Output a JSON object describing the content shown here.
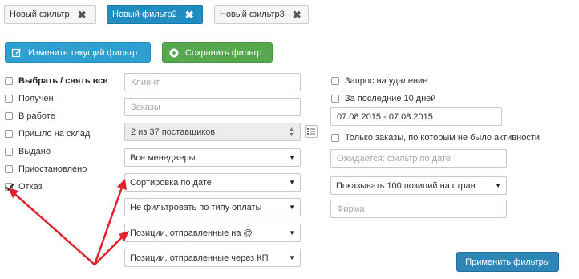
{
  "tabs": [
    {
      "label": "Новый фильтр",
      "active": false
    },
    {
      "label": "Новый фильтр2",
      "active": true
    },
    {
      "label": "Новый фильтр3",
      "active": false
    }
  ],
  "actions": {
    "edit_label": "Изменить текущий фильтр",
    "save_label": "Сохранить фильтр"
  },
  "statuses": [
    {
      "label": "Выбрать / снять все",
      "checked": false
    },
    {
      "label": "Получен",
      "checked": false
    },
    {
      "label": "В работе",
      "checked": false
    },
    {
      "label": "Пришло на склад",
      "checked": false
    },
    {
      "label": "Выдано",
      "checked": false
    },
    {
      "label": "Приостановлено",
      "checked": false
    },
    {
      "label": "Отказ",
      "checked": true
    }
  ],
  "middle": {
    "client_placeholder": "Клиент",
    "orders_placeholder": "Заказы",
    "suppliers_value": "2 из 37 поставщиков",
    "managers_value": "Все менеджеры",
    "sort_value": "Сортировка по дате",
    "payment_value": "Не фильтровать по типу оплаты",
    "sent_email_value": "Позиции, отправленные на @",
    "sent_kp_value": "Позиции, отправленные через КП"
  },
  "right": {
    "delete_request_label": "Запрос на удаление",
    "last10_label": "За последние 10 дней",
    "date_range": "07.08.2015 - 07.08.2015",
    "inactive_label": "Только заказы, по которым не было активности",
    "waiting_placeholder": "Ожидается: фильтр по дате",
    "show_value": "Показывать 100 позиций на стран",
    "company_placeholder": "Фирма"
  },
  "apply_label": "Применить фильтры",
  "colors": {
    "tab_active": "#1f8dbf",
    "edit_button": "#2e9fd1",
    "save_button": "#55a84d",
    "apply_button": "#2e86b8",
    "annotation_arrow": "#e0202a"
  },
  "icons": {
    "tab_close": "close-icon",
    "edit": "edit-icon",
    "save": "plus-circle-icon",
    "select_arrow": "triangle-down-icon",
    "list": "list-icon",
    "spinner": "stepper-icon"
  }
}
